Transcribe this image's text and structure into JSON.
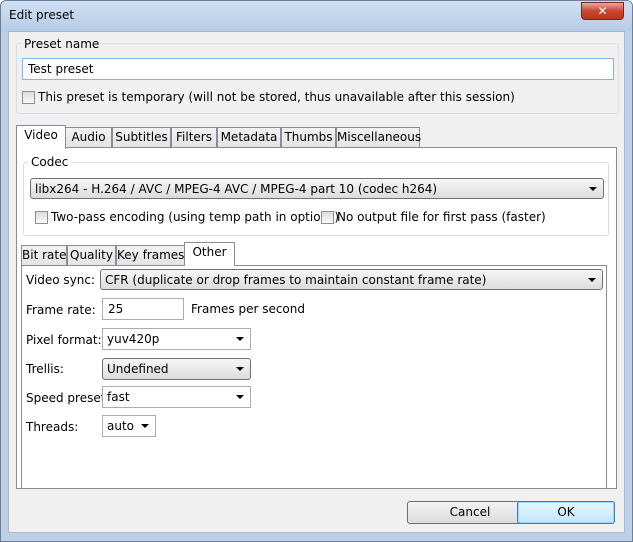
{
  "window": {
    "title": "Edit preset",
    "close_glyph": "✕"
  },
  "preset_name": {
    "group_title": "Preset name",
    "value": "Test preset"
  },
  "temporary_checkbox": {
    "label": "This preset is temporary (will not be stored, thus unavailable after this session)",
    "checked": false
  },
  "main_tabs": [
    "Video",
    "Audio",
    "Subtitles",
    "Filters",
    "Metadata",
    "Thumbs",
    "Miscellaneous"
  ],
  "codec": {
    "group_title": "Codec",
    "selected": "libx264 - H.264 / AVC / MPEG-4 AVC / MPEG-4 part 10 (codec h264)",
    "two_pass_label": "Two-pass encoding (using temp path in options)",
    "no_output_label": "No output file for first pass (faster)"
  },
  "sub_tabs": [
    "Bit rate",
    "Quality",
    "Key frames",
    "Other"
  ],
  "other": {
    "video_sync_label": "Video sync:",
    "video_sync_value": "CFR (duplicate or drop frames to maintain constant frame rate)",
    "frame_rate_label": "Frame rate:",
    "frame_rate_value": "25",
    "frame_rate_unit": "Frames per second",
    "pixel_format_label": "Pixel format:",
    "pixel_format_value": "yuv420p",
    "trellis_label": "Trellis:",
    "trellis_value": "Undefined",
    "speed_preset_label": "Speed preset:",
    "speed_preset_value": "fast",
    "threads_label": "Threads:",
    "threads_value": "auto"
  },
  "buttons": {
    "cancel": "Cancel",
    "ok": "OK"
  },
  "icons": {
    "dropdown": "chevron-down-icon",
    "close": "close-icon"
  }
}
